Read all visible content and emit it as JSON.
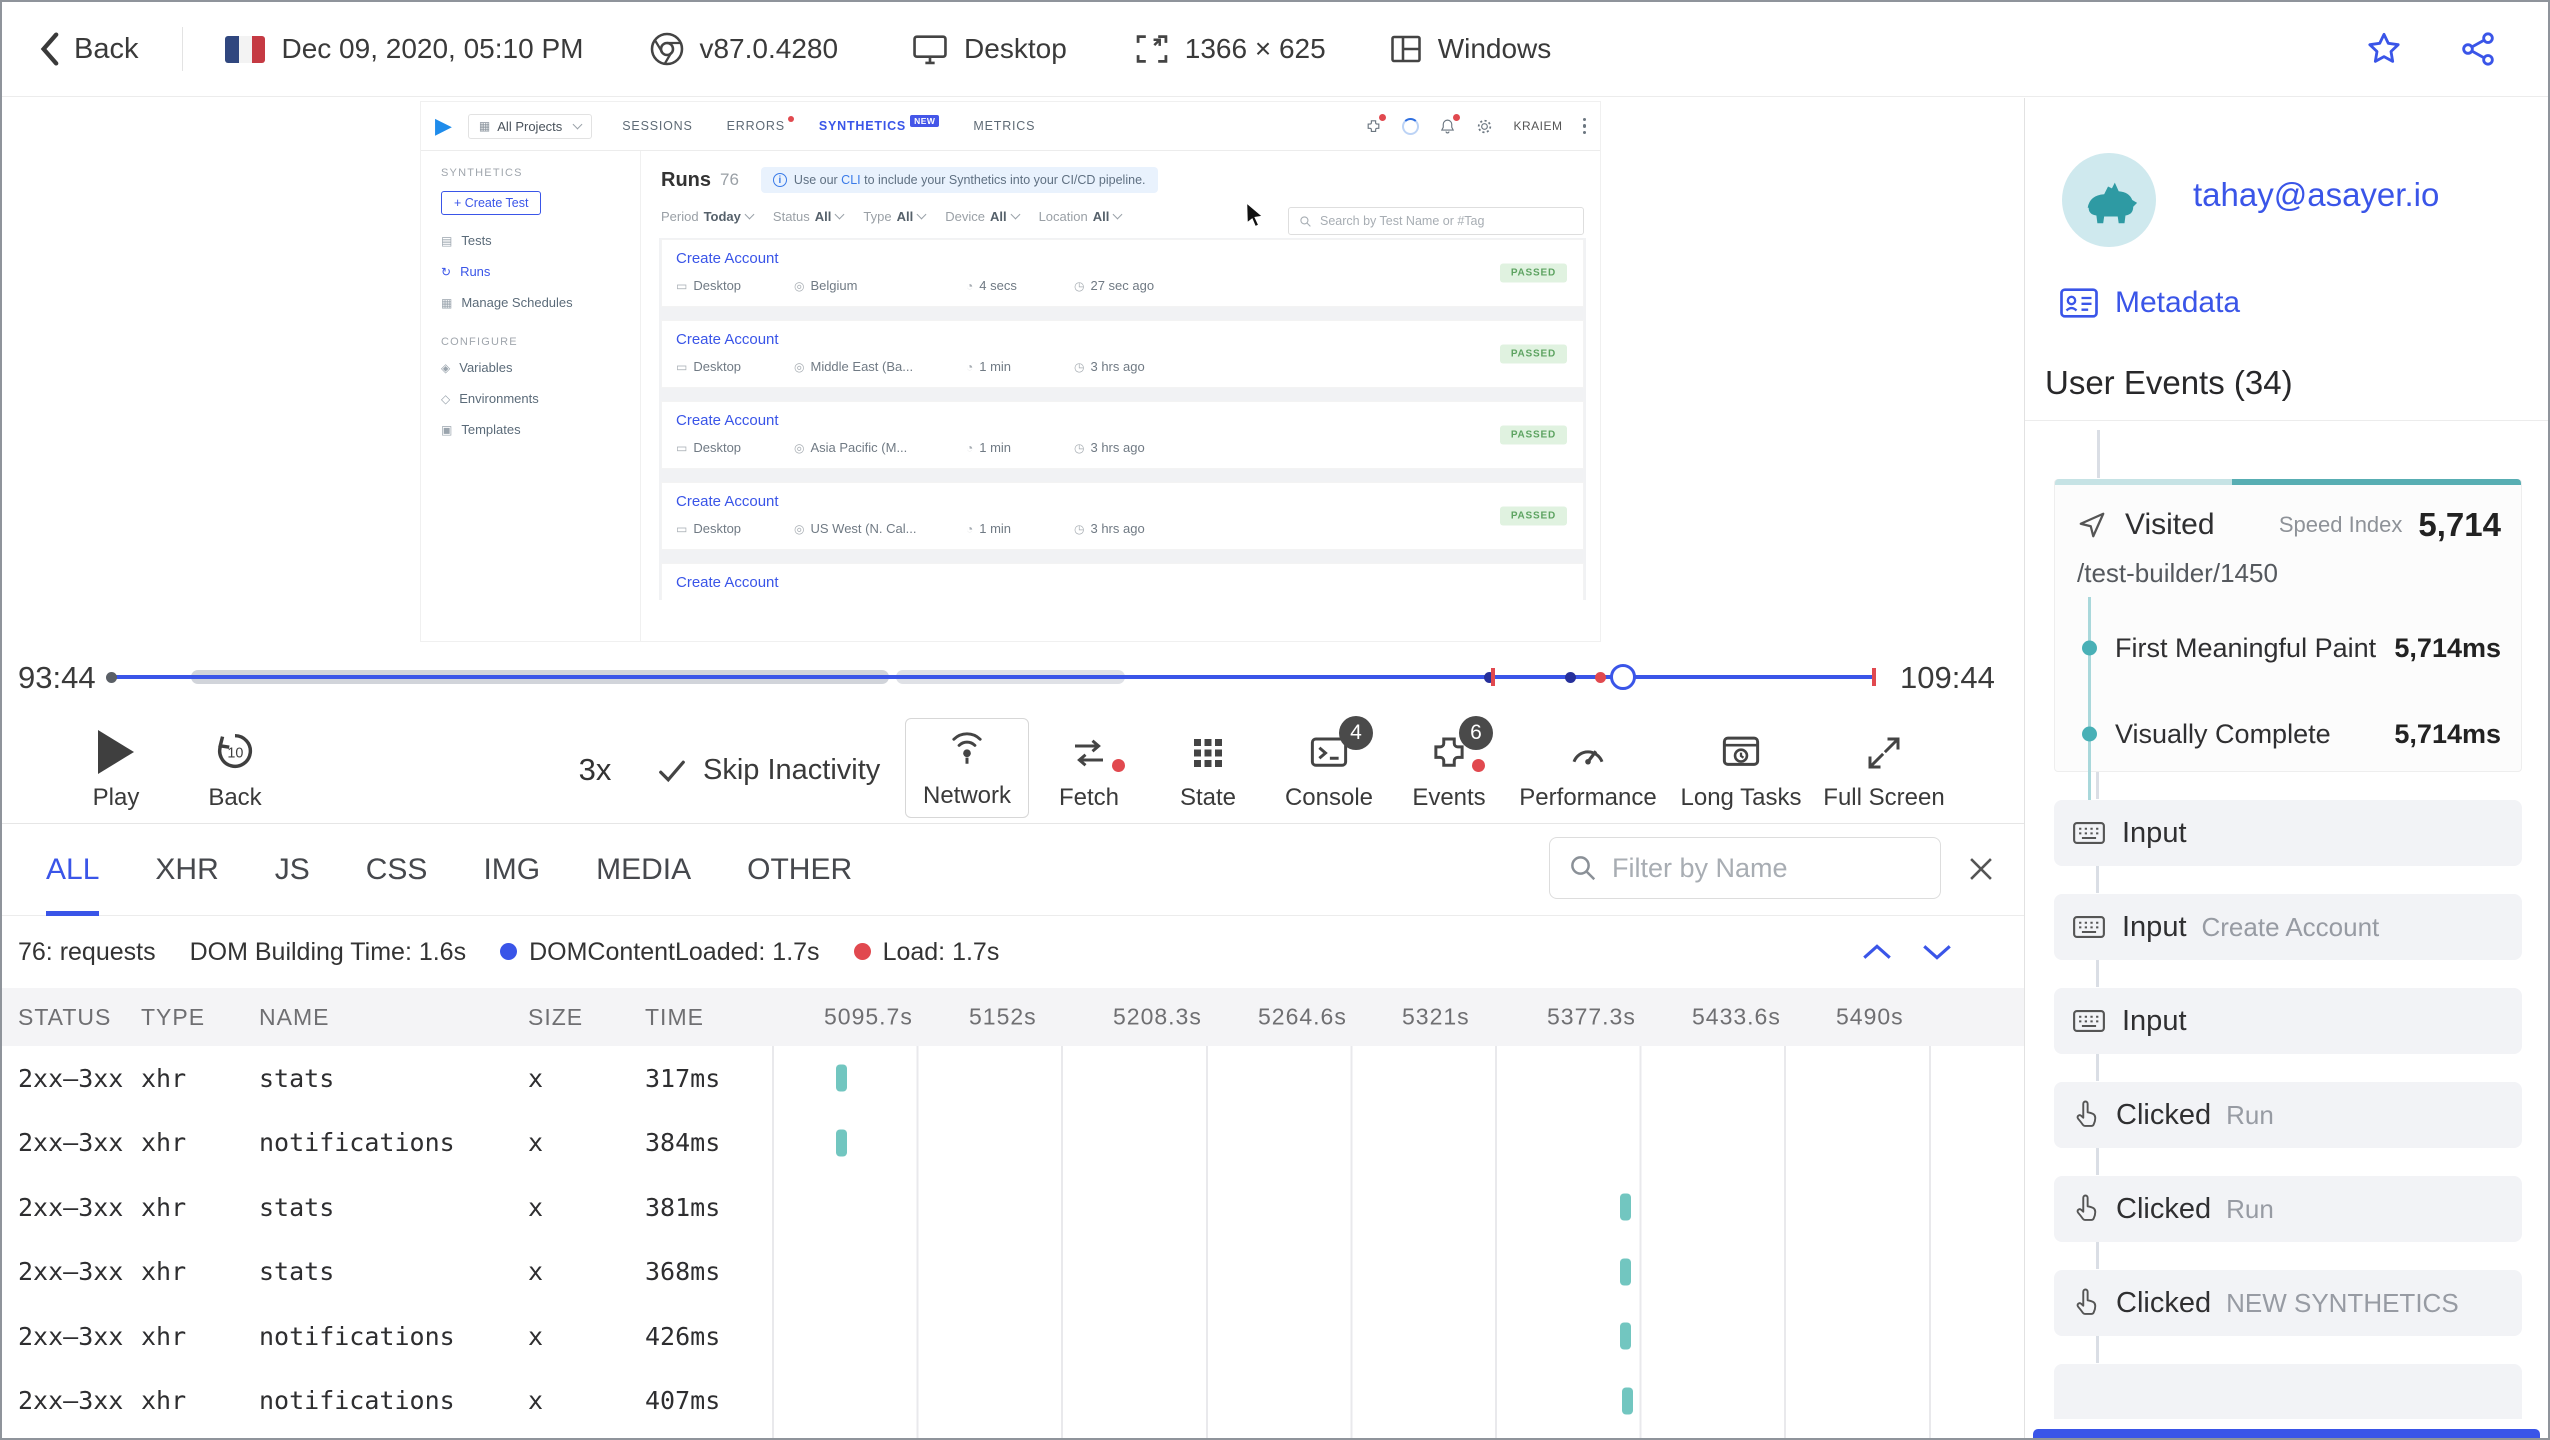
{
  "topbar": {
    "back": "Back",
    "datetime": "Dec 09, 2020, 05:10 PM",
    "browser": "v87.0.4280",
    "device": "Desktop",
    "resolution": "1366 × 625",
    "os": "Windows"
  },
  "app": {
    "project": "All Projects",
    "tabs": [
      "SESSIONS",
      "ERRORS",
      "SYNTHETICS",
      "METRICS"
    ],
    "new_badge": "NEW",
    "user": "KRAIEM",
    "nav": {
      "synthetics": "SYNTHETICS",
      "create_test": "+ Create Test",
      "tests": "Tests",
      "runs": "Runs",
      "schedules": "Manage Schedules",
      "configure": "CONFIGURE",
      "variables": "Variables",
      "environments": "Environments",
      "templates": "Templates"
    },
    "runs_title": "Runs",
    "runs_count": "76",
    "banner_pre": "Use our ",
    "banner_link": "CLI",
    "banner_post": " to include your Synthetics into your CI/CD pipeline.",
    "filters": [
      {
        "label": "Period",
        "value": "Today"
      },
      {
        "label": "Status",
        "value": "All"
      },
      {
        "label": "Type",
        "value": "All"
      },
      {
        "label": "Device",
        "value": "All"
      },
      {
        "label": "Location",
        "value": "All"
      }
    ],
    "search_placeholder": "Search by Test Name or #Tag",
    "runs": [
      {
        "name": "Create Account",
        "device": "Desktop",
        "location": "Belgium",
        "duration": "4 secs",
        "ago": "27 sec ago",
        "status": "PASSED"
      },
      {
        "name": "Create Account",
        "device": "Desktop",
        "location": "Middle East (Ba...",
        "duration": "1 min",
        "ago": "3 hrs ago",
        "status": "PASSED"
      },
      {
        "name": "Create Account",
        "device": "Desktop",
        "location": "Asia Pacific (M...",
        "duration": "1 min",
        "ago": "3 hrs ago",
        "status": "PASSED"
      },
      {
        "name": "Create Account",
        "device": "Desktop",
        "location": "US West (N. Cal...",
        "duration": "1 min",
        "ago": "3 hrs ago",
        "status": "PASSED"
      },
      {
        "name": "Create Account",
        "device": "",
        "location": "",
        "duration": "",
        "ago": "",
        "status": ""
      }
    ]
  },
  "timeline": {
    "current": "93:44",
    "total": "109:44",
    "progress_pct": 85.7,
    "markers": [
      {
        "type": "dot",
        "pct": 77.8
      },
      {
        "type": "tick",
        "pct": 78.2
      },
      {
        "type": "dot",
        "pct": 82.4
      },
      {
        "type": "dot-red",
        "pct": 84.1
      },
      {
        "type": "tick",
        "pct": 99.8
      }
    ]
  },
  "controls": {
    "play": "Play",
    "back": "Back",
    "back_num": "10",
    "speed": "3x",
    "skip": "Skip Inactivity",
    "network": "Network",
    "fetch": "Fetch",
    "state": "State",
    "console": "Console",
    "console_badge": "4",
    "events": "Events",
    "events_badge": "6",
    "performance": "Performance",
    "long_tasks": "Long Tasks",
    "full_screen": "Full Screen"
  },
  "network": {
    "tabs": [
      "ALL",
      "XHR",
      "JS",
      "CSS",
      "IMG",
      "MEDIA",
      "OTHER"
    ],
    "active_tab": "ALL",
    "filter_placeholder": "Filter by Name",
    "requests": "76: requests",
    "dom_building": "DOM Building Time: 1.6s",
    "dcl": "DOMContentLoaded: 1.7s",
    "load": "Load: 1.7s",
    "columns": [
      "STATUS",
      "TYPE",
      "NAME",
      "SIZE",
      "TIME"
    ],
    "time_columns": [
      "5095.7s",
      "5152s",
      "5208.3s",
      "5264.6s",
      "5321s",
      "5377.3s",
      "5433.6s",
      "5490s"
    ],
    "rows": [
      {
        "status": "2xx–3xx",
        "type": "xhr",
        "name": "stats",
        "size": "x",
        "time": "317ms",
        "bar_pct": 5.1
      },
      {
        "status": "2xx–3xx",
        "type": "xhr",
        "name": "notifications",
        "size": "x",
        "time": "384ms",
        "bar_pct": 5.1
      },
      {
        "status": "2xx–3xx",
        "type": "xhr",
        "name": "stats",
        "size": "x",
        "time": "381ms",
        "bar_pct": 67.7
      },
      {
        "status": "2xx–3xx",
        "type": "xhr",
        "name": "stats",
        "size": "x",
        "time": "368ms",
        "bar_pct": 67.7
      },
      {
        "status": "2xx–3xx",
        "type": "xhr",
        "name": "notifications",
        "size": "x",
        "time": "426ms",
        "bar_pct": 67.7
      },
      {
        "status": "2xx–3xx",
        "type": "xhr",
        "name": "notifications",
        "size": "x",
        "time": "407ms",
        "bar_pct": 67.9
      }
    ]
  },
  "user_panel": {
    "email": "tahay@asayer.io",
    "metadata": "Metadata",
    "events_title": "User Events (34)",
    "visited": {
      "label": "Visited",
      "speed_index_label": "Speed Index",
      "speed_index_value": "5,714",
      "path": "/test-builder/1450",
      "metrics": [
        {
          "label": "First Meaningful Paint",
          "value": "5,714ms"
        },
        {
          "label": "Visually Complete",
          "value": "5,714ms"
        }
      ]
    },
    "events": [
      {
        "kind": "input",
        "label": "Input",
        "detail": ""
      },
      {
        "kind": "input",
        "label": "Input",
        "detail": "Create Account"
      },
      {
        "kind": "input",
        "label": "Input",
        "detail": ""
      },
      {
        "kind": "click",
        "label": "Clicked",
        "detail": "Run"
      },
      {
        "kind": "click",
        "label": "Clicked",
        "detail": "Run"
      },
      {
        "kind": "click",
        "label": "Clicked",
        "detail": "NEW SYNTHETICS"
      }
    ]
  }
}
